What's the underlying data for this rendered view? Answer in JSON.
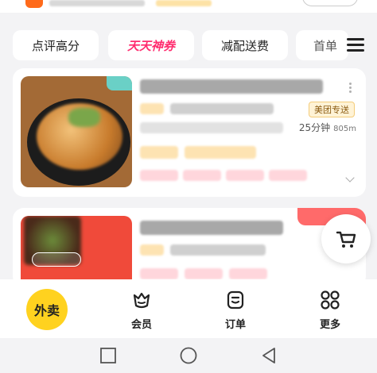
{
  "filters": {
    "chips": [
      "点评高分",
      "天天神券",
      "减配送费",
      "首单"
    ]
  },
  "store1": {
    "delivery_tag": "美团专送",
    "delivery_time": "25分钟",
    "distance": "805m"
  },
  "bottom_nav": {
    "items": [
      {
        "label": "外卖",
        "icon": "waimai-badge"
      },
      {
        "label": "会员",
        "icon": "crown-icon"
      },
      {
        "label": "订单",
        "icon": "order-icon"
      },
      {
        "label": "更多",
        "icon": "grid-icon"
      }
    ]
  },
  "colors": {
    "accent_yellow": "#ffd21f",
    "hot_pink": "#ff2d6f",
    "brand_orange": "#ff6a1a"
  }
}
